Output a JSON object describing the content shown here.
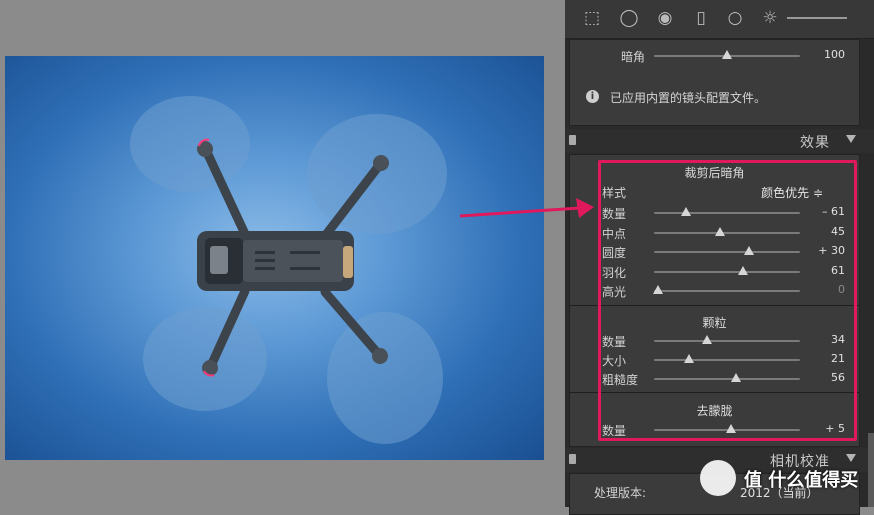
{
  "toolbar": {
    "icons": [
      "grid-select-icon",
      "circle-arrow-icon",
      "radial-filter-icon",
      "rectangle-icon",
      "circle-icon",
      "sun-slider-icon"
    ]
  },
  "lens": {
    "vignette_label": "暗角",
    "vignette_value": "100",
    "vignette_pos": 0.5,
    "info_text": "已应用内置的镜头配置文件。"
  },
  "effects": {
    "title": "效果",
    "post_crop": {
      "title": "裁剪后暗角",
      "style_label": "样式",
      "style_value": "颜色优先 ≑",
      "sliders": [
        {
          "label": "数量",
          "value": "– 61",
          "pos": 0.22,
          "dim": false
        },
        {
          "label": "中点",
          "value": "45",
          "pos": 0.45,
          "dim": false
        },
        {
          "label": "圆度",
          "value": "+ 30",
          "pos": 0.65,
          "dim": false
        },
        {
          "label": "羽化",
          "value": "61",
          "pos": 0.61,
          "dim": false
        },
        {
          "label": "高光",
          "value": "0",
          "pos": 0.03,
          "dim": true
        }
      ]
    },
    "grain": {
      "title": "颗粒",
      "sliders": [
        {
          "label": "数量",
          "value": "34",
          "pos": 0.36
        },
        {
          "label": "大小",
          "value": "21",
          "pos": 0.24
        },
        {
          "label": "粗糙度",
          "value": "56",
          "pos": 0.56
        }
      ]
    },
    "dehaze": {
      "title": "去朦胧",
      "sliders": [
        {
          "label": "数量",
          "value": "+ 5",
          "pos": 0.53
        }
      ]
    }
  },
  "camera_calibration": {
    "title": "相机校准",
    "process_label": "处理版本:",
    "process_value": "2012（当前）"
  },
  "watermark": {
    "text": "值 什么值得买"
  },
  "colors": {
    "highlight": "#e0195d",
    "sky": "#3a7cc3"
  }
}
